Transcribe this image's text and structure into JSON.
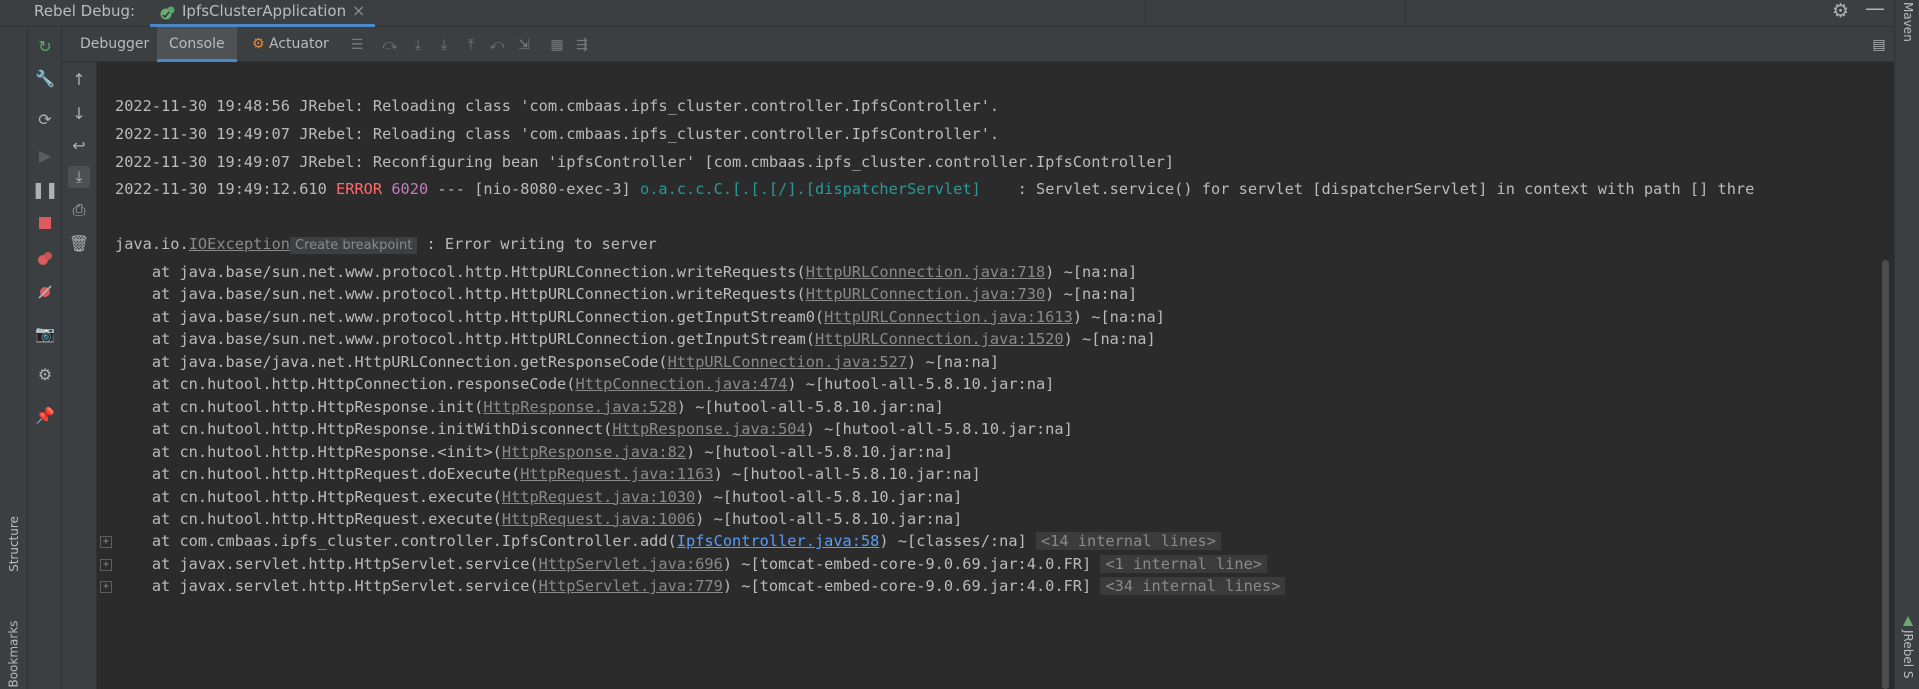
{
  "titlebar": {
    "rebel_label": "Rebel Debug:",
    "tab_label": "IpfsClusterApplication",
    "tab_close": "×"
  },
  "tabs": {
    "debugger": "Debugger",
    "console": "Console",
    "actuator": "Actuator"
  },
  "side": {
    "structure": "Structure",
    "bookmarks": "Bookmarks",
    "maven": "Maven",
    "jrebel": "JRebel S"
  },
  "console": {
    "lines": [
      "2022-11-30 19:48:56 JRebel: Reloading class 'com.cmbaas.ipfs_cluster.controller.IpfsController'.",
      "2022-11-30 19:49:07 JRebel: Reloading class 'com.cmbaas.ipfs_cluster.controller.IpfsController'.",
      "2022-11-30 19:49:07 JRebel: Reconfiguring bean 'ipfsController' [com.cmbaas.ipfs_cluster.controller.IpfsController]"
    ],
    "error_line": {
      "ts": "2022-11-30 19:49:12.610 ",
      "level": "ERROR",
      "pid": "6020",
      "mid": " --- [nio-8080-exec-3] ",
      "logger": "o.a.c.c.C.[.[.[/].[dispatcherServlet]",
      "msg": "    : Servlet.service() for servlet [dispatcherServlet] in context with path [] thre"
    },
    "exception": {
      "pkg": "java.io.",
      "cls": "IOException",
      "breakpoint": "Create breakpoint",
      "msg": ": Error writing to server"
    },
    "stack": [
      {
        "pre": "    at java.base/sun.net.www.protocol.http.HttpURLConnection.writeRequests(",
        "link": "HttpURLConnection.java:718",
        "post": ") ~[na:na]"
      },
      {
        "pre": "    at java.base/sun.net.www.protocol.http.HttpURLConnection.writeRequests(",
        "link": "HttpURLConnection.java:730",
        "post": ") ~[na:na]"
      },
      {
        "pre": "    at java.base/sun.net.www.protocol.http.HttpURLConnection.getInputStream0(",
        "link": "HttpURLConnection.java:1613",
        "post": ") ~[na:na]"
      },
      {
        "pre": "    at java.base/sun.net.www.protocol.http.HttpURLConnection.getInputStream(",
        "link": "HttpURLConnection.java:1520",
        "post": ") ~[na:na]"
      },
      {
        "pre": "    at java.base/java.net.HttpURLConnection.getResponseCode(",
        "link": "HttpURLConnection.java:527",
        "post": ") ~[na:na]"
      },
      {
        "pre": "    at cn.hutool.http.HttpConnection.responseCode(",
        "link": "HttpConnection.java:474",
        "post": ") ~[hutool-all-5.8.10.jar:na]"
      },
      {
        "pre": "    at cn.hutool.http.HttpResponse.init(",
        "link": "HttpResponse.java:528",
        "post": ") ~[hutool-all-5.8.10.jar:na]"
      },
      {
        "pre": "    at cn.hutool.http.HttpResponse.initWithDisconnect(",
        "link": "HttpResponse.java:504",
        "post": ") ~[hutool-all-5.8.10.jar:na]"
      },
      {
        "pre": "    at cn.hutool.http.HttpResponse.<init>(",
        "link": "HttpResponse.java:82",
        "post": ") ~[hutool-all-5.8.10.jar:na]"
      },
      {
        "pre": "    at cn.hutool.http.HttpRequest.doExecute(",
        "link": "HttpRequest.java:1163",
        "post": ") ~[hutool-all-5.8.10.jar:na]"
      },
      {
        "pre": "    at cn.hutool.http.HttpRequest.execute(",
        "link": "HttpRequest.java:1030",
        "post": ") ~[hutool-all-5.8.10.jar:na]"
      },
      {
        "pre": "    at cn.hutool.http.HttpRequest.execute(",
        "link": "HttpRequest.java:1006",
        "post": ") ~[hutool-all-5.8.10.jar:na]"
      }
    ],
    "folded": [
      {
        "pre": "    at com.cmbaas.ipfs_cluster.controller.IpfsController.add(",
        "link": "IpfsController.java:58",
        "post": ") ~[classes/:na]",
        "fold": "<14 internal lines>"
      },
      {
        "pre": "    at javax.servlet.http.HttpServlet.service(",
        "link": "HttpServlet.java:696",
        "post": ") ~[tomcat-embed-core-9.0.69.jar:4.0.FR]",
        "fold": "<1 internal line>"
      },
      {
        "pre": "    at javax.servlet.http.HttpServlet.service(",
        "link": "HttpServlet.java:779",
        "post": ") ~[tomcat-embed-core-9.0.69.jar:4.0.FR]",
        "fold": "<34 internal lines>"
      }
    ]
  },
  "colors": {
    "accent": "#4a88c7",
    "error": "#ff6b68",
    "pid": "#c77dbb",
    "logger": "#299999",
    "link_blue": "#589df6"
  },
  "icons": [
    "rerun-icon",
    "wrench-icon",
    "restart-icon",
    "resume-icon",
    "pause-icon",
    "stop-icon",
    "view-breakpoints-icon",
    "mute-breakpoints-icon",
    "camera-icon",
    "settings-icon",
    "pin-icon",
    "arrow-up-icon",
    "arrow-down-icon",
    "soft-wrap-icon",
    "scroll-to-end-icon",
    "print-icon",
    "trash-icon",
    "gear-icon",
    "minimize-icon",
    "layout-icon"
  ]
}
